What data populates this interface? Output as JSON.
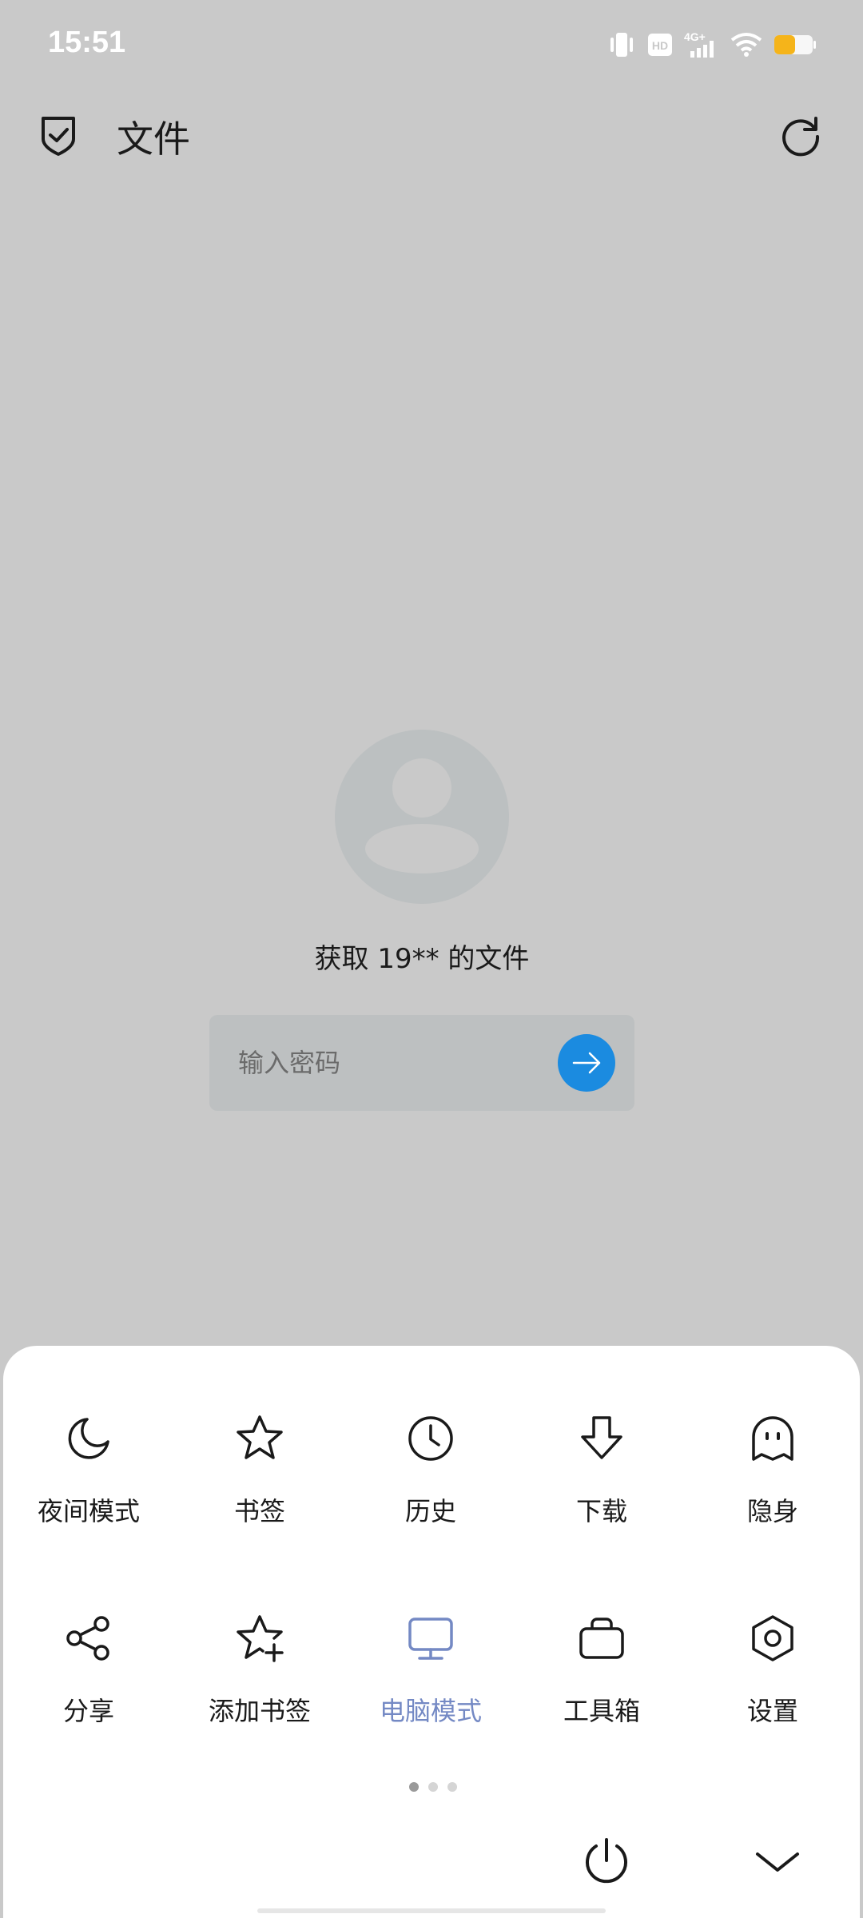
{
  "status_bar": {
    "time": "15:51",
    "network_label": "4G+",
    "hd_label": "HD",
    "battery_color": "#f5b41a"
  },
  "app_bar": {
    "title": "文件",
    "icons": [
      "shield-check-icon",
      "refresh-icon"
    ]
  },
  "main": {
    "file_title": "获取 19** 的文件",
    "password_placeholder": "输入密码",
    "submit_icon": "arrow-right-icon",
    "accent_color": "#1b8be0"
  },
  "menu": {
    "items": [
      {
        "label": "夜间模式",
        "icon": "moon-icon"
      },
      {
        "label": "书签",
        "icon": "star-icon"
      },
      {
        "label": "历史",
        "icon": "clock-icon"
      },
      {
        "label": "下载",
        "icon": "download-arrow-icon"
      },
      {
        "label": "隐身",
        "icon": "ghost-icon"
      },
      {
        "label": "分享",
        "icon": "share-icon"
      },
      {
        "label": "添加书签",
        "icon": "star-plus-icon"
      },
      {
        "label": "电脑模式",
        "icon": "monitor-icon",
        "active": true
      },
      {
        "label": "工具箱",
        "icon": "toolbox-icon"
      },
      {
        "label": "设置",
        "icon": "settings-hex-icon"
      }
    ],
    "active_color": "#7489c4",
    "page_count": 3,
    "current_page": 1,
    "bottom_icons": [
      "power-icon",
      "chevron-down-icon"
    ]
  }
}
